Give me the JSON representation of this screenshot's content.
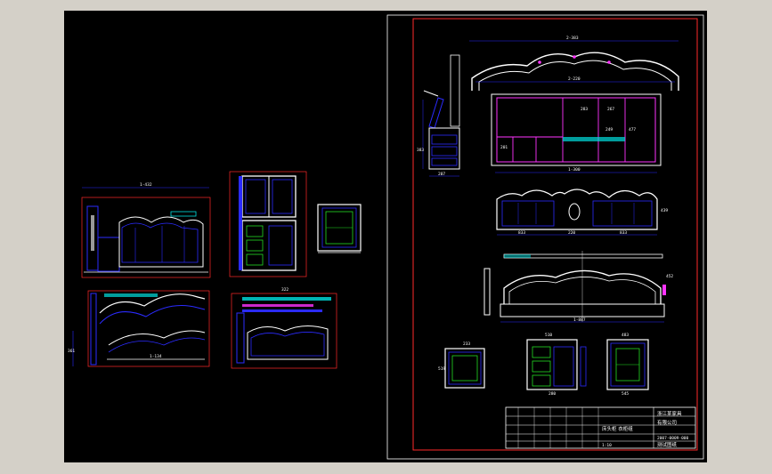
{
  "title_block": {
    "company_line1": "浙江某家具",
    "company_line2": "有限公司",
    "drawing_name": "床头柜 衣柜组",
    "code": "2007-0009-000",
    "scale": "1:10",
    "status": "测试图纸"
  },
  "dims": {
    "top_width": "2-383",
    "inner_width": "2-220",
    "bottom_width": "1-300",
    "side_height": "383",
    "side_depth": "207",
    "compartment_a": "283",
    "compartment_b": "267",
    "compartment_c": "477",
    "compartment_d": "249",
    "compartment_e": "201",
    "panel_left": "833",
    "panel_mid": "220",
    "panel_right": "833",
    "panel_height": "439",
    "headboard_width": "1-887",
    "headboard_height": "452",
    "small_a": "233",
    "small_b": "519",
    "small_c": "510",
    "small_d": "280",
    "small_e": "483",
    "small_f": "545",
    "left_top_width": "1-432",
    "left_bottom_width": "1-134",
    "left_mid_width": "322",
    "left_vertical": "361"
  },
  "colors": {
    "background": "#000000",
    "frame": "#ffffff",
    "border": "#ff2a2a",
    "outline": "#2b2bff",
    "detail": "#ffffff",
    "accent_cyan": "#00e0e0",
    "accent_magenta": "#ff33ff",
    "accent_green": "#22dd22"
  }
}
